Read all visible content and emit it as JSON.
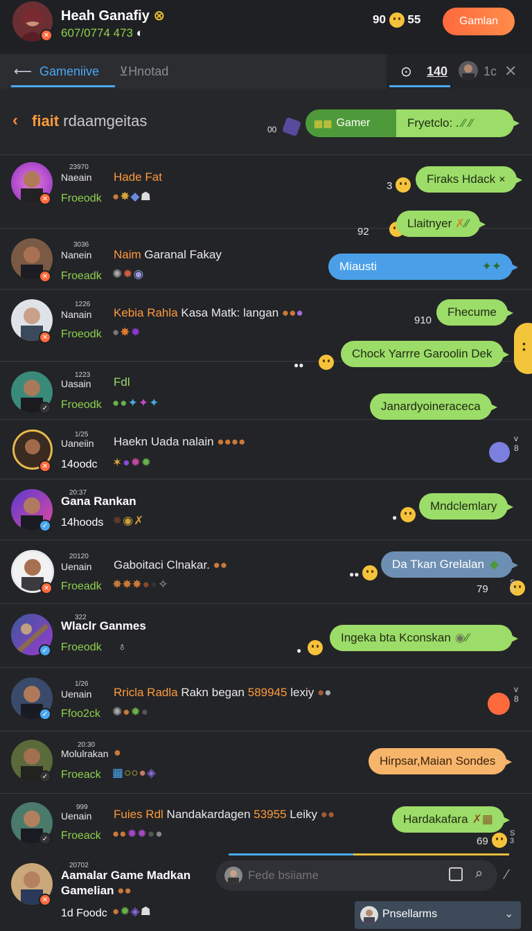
{
  "header": {
    "user_name": "Heah Ganafiy",
    "user_sub": "607/0774 473",
    "coins_left": "90",
    "coins_right": "55",
    "action_button": "Gamlan"
  },
  "tabs": {
    "tab1": "Gameniive",
    "tab2": "Hnotad",
    "count": "140",
    "extra": "1c"
  },
  "subheader": {
    "title_orange": "fiait",
    "title_rest": "rdaamgeitas",
    "dots": "00",
    "bubble_dark_label": "Gamer",
    "bubble_label": "Fryetclo: ."
  },
  "rows": [
    {
      "time": "23970",
      "uname": "Naeain",
      "title": "Hade Fat",
      "title_rest": "",
      "status": "Froeodk",
      "bubble": "Firaks Hdack",
      "num": "3",
      "bubble2": "Llaitnyer",
      "num2": "92"
    },
    {
      "time": "3036",
      "uname": "Nanein",
      "title": "Naim",
      "title_rest": "Garanal Fakay",
      "status": "Froeadk",
      "bubble": "Miausti"
    },
    {
      "time": "1226",
      "uname": "Nanain",
      "title": "Kebia Rahla",
      "title_rest": "Kasa Matk: langan",
      "status": "Froeodk",
      "bubble": "Fhecume",
      "num": "910",
      "bubble2": "Chock Yarrre Garoolin Dek"
    },
    {
      "time": "1223",
      "uname": "Uasain",
      "title": "Fdl",
      "title_rest": "",
      "status": "Froeodk",
      "bubble": "Janardyoineraceca"
    },
    {
      "time": "1/25",
      "uname": "Uaneiin",
      "title": "",
      "title_rest": "Haekn Uada nalain",
      "status": "14oodc"
    },
    {
      "time": "20:37",
      "uname": "",
      "title": "",
      "title_rest": "Gana Rankan",
      "status": "14hoods",
      "bubble": "Mndclemlary"
    },
    {
      "time": "20120",
      "uname": "Uenain",
      "title": "",
      "title_rest": "Gaboitaci Clnakar.",
      "status": "Froeadk",
      "bubble": "Da Tkan Grelalan",
      "num": "79"
    },
    {
      "time": "322",
      "uname": "",
      "title": "",
      "title_rest": "Wlaclr Ganmes",
      "status": "Froeodk",
      "bubble": "Ingeka bta Kconskan"
    },
    {
      "time": "1/26",
      "uname": "Uenain",
      "title": "Rricla Radla",
      "title_rest": "Rakn began",
      "title_num": "589945",
      "title_tail": "lexiy",
      "status": "Ffoo2ck"
    },
    {
      "time": "20:30",
      "uname": "Molulrakan",
      "title": "",
      "title_rest": "",
      "status": "Froeack",
      "bubble": "Hirpsar,Maian Sondes"
    },
    {
      "time": "999",
      "uname": "Uenain",
      "title": "Fuies Rdl",
      "title_rest": "Nandakardagen",
      "title_num": "53955",
      "title_tail": "Leiky",
      "status": "Froeack",
      "bubble": "Hardakafara",
      "num": "69"
    }
  ],
  "bottom": {
    "time": "20702",
    "name": "Aamalar Game Madkan",
    "name2": "Gamelian",
    "status": "1d Foodc",
    "search_placeholder": "Fede bsiiame",
    "dropdown": "Pnsellarms"
  }
}
